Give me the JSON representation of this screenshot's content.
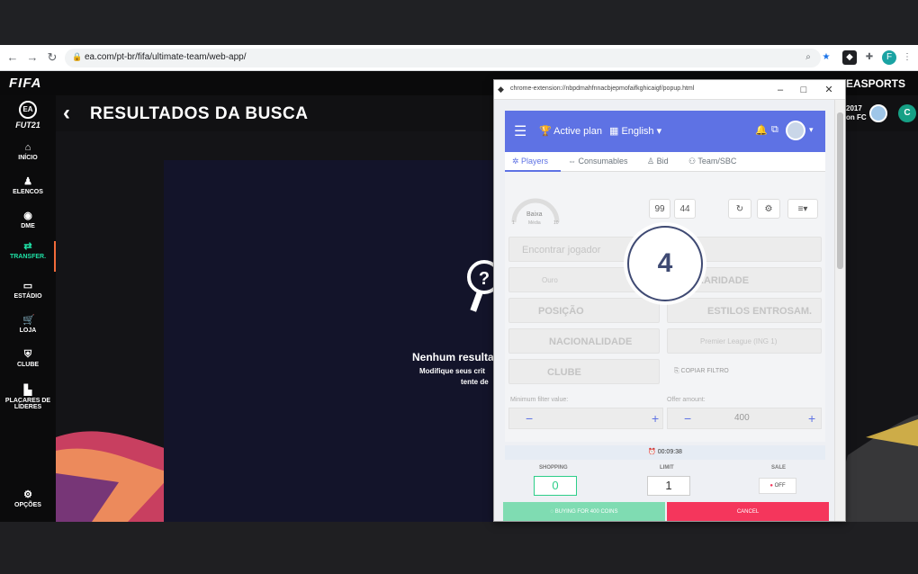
{
  "browser": {
    "url": "ea.com/pt-br/fifa/ultimate-team/web-app/"
  },
  "fifa": {
    "logo": "FIFA",
    "brand": "EASPORTS",
    "game_logo": "FUT21",
    "page_title": "RESULTADOS DA BUSCA",
    "club_line1": "2017",
    "club_line2": "on FC",
    "sidebar": [
      {
        "label": "INÍCIO",
        "icon": "home-icon"
      },
      {
        "label": "ELENCOS",
        "icon": "squad-icon"
      },
      {
        "label": "DME",
        "icon": "dme-icon"
      },
      {
        "label": "TRANSFER.",
        "icon": "transfer-icon"
      },
      {
        "label": "ESTÁDIO",
        "icon": "stadium-icon"
      },
      {
        "label": "LOJA",
        "icon": "store-icon"
      },
      {
        "label": "CLUBE",
        "icon": "club-icon"
      },
      {
        "label": "PLACARES DE",
        "label2": "LÍDERES",
        "icon": "leaderboard-icon"
      },
      {
        "label": "OPÇÕES",
        "icon": "settings-icon"
      }
    ],
    "empty_title": "Nenhum resultad",
    "empty_sub1": "Modifique seus crit",
    "empty_sub2": "tente de"
  },
  "popup": {
    "url": "chrome-extension://nbpdmahfnnacbjepmofaifkghicaigf/popup.html",
    "header": {
      "plan": "Active plan",
      "language": "English"
    },
    "tabs": [
      "Players",
      "Consumables",
      "Bid",
      "Team/SBC"
    ],
    "gauge_label": "Baixa",
    "gauge_min": "1",
    "gauge_mid": "Média",
    "gauge_max": "10",
    "count1": "99",
    "count2": "44",
    "search_placeholder": "Encontrar jogador",
    "quality": "Ouro",
    "rarity": "RARIDADE",
    "position": "POSIÇÃO",
    "chem_style": "ESTILOS ENTROSAM.",
    "nationality": "NACIONALIDADE",
    "league": "Premier League (ING 1)",
    "club": "CLUBE",
    "copy_filter": "COPIAR FILTRO",
    "min_filter_label": "Minimum filter value:",
    "offer_label": "Offer amount:",
    "offer_value": "400",
    "step_number": "4",
    "timer": "00:09:38",
    "shopping_label": "SHOPPING",
    "shopping_value": "0",
    "limit_label": "LIMIT",
    "limit_value": "1",
    "sale_label": "SALE",
    "sale_state": "OFF",
    "green_button": "BUYING FOR 400 COINS",
    "red_button": "CANCEL"
  }
}
